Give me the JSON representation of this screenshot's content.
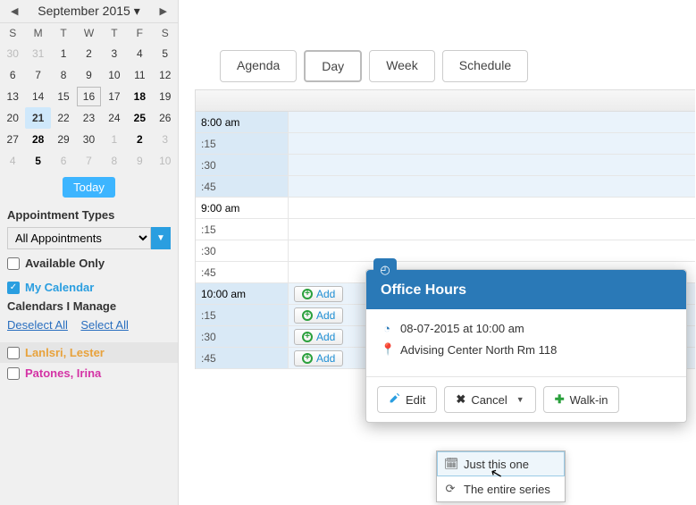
{
  "sidebar": {
    "month_title": "September 2015 ▾",
    "dow": [
      "S",
      "M",
      "T",
      "W",
      "T",
      "F",
      "S"
    ],
    "weeks": [
      [
        {
          "d": "30",
          "c": "other"
        },
        {
          "d": "31",
          "c": "other"
        },
        {
          "d": "1",
          "c": ""
        },
        {
          "d": "2",
          "c": ""
        },
        {
          "d": "3",
          "c": ""
        },
        {
          "d": "4",
          "c": ""
        },
        {
          "d": "5",
          "c": ""
        }
      ],
      [
        {
          "d": "6",
          "c": ""
        },
        {
          "d": "7",
          "c": ""
        },
        {
          "d": "8",
          "c": ""
        },
        {
          "d": "9",
          "c": ""
        },
        {
          "d": "10",
          "c": ""
        },
        {
          "d": "11",
          "c": ""
        },
        {
          "d": "12",
          "c": ""
        }
      ],
      [
        {
          "d": "13",
          "c": ""
        },
        {
          "d": "14",
          "c": ""
        },
        {
          "d": "15",
          "c": ""
        },
        {
          "d": "16",
          "c": "outlined"
        },
        {
          "d": "17",
          "c": ""
        },
        {
          "d": "18",
          "c": "bold"
        },
        {
          "d": "19",
          "c": ""
        }
      ],
      [
        {
          "d": "20",
          "c": ""
        },
        {
          "d": "21",
          "c": "today-blue"
        },
        {
          "d": "22",
          "c": ""
        },
        {
          "d": "23",
          "c": ""
        },
        {
          "d": "24",
          "c": ""
        },
        {
          "d": "25",
          "c": "bold"
        },
        {
          "d": "26",
          "c": ""
        }
      ],
      [
        {
          "d": "27",
          "c": ""
        },
        {
          "d": "28",
          "c": "bold"
        },
        {
          "d": "29",
          "c": ""
        },
        {
          "d": "30",
          "c": ""
        },
        {
          "d": "1",
          "c": "other"
        },
        {
          "d": "2",
          "c": "other bold"
        },
        {
          "d": "3",
          "c": "other"
        }
      ],
      [
        {
          "d": "4",
          "c": "other"
        },
        {
          "d": "5",
          "c": "other bold"
        },
        {
          "d": "6",
          "c": "other"
        },
        {
          "d": "7",
          "c": "other"
        },
        {
          "d": "8",
          "c": "other"
        },
        {
          "d": "9",
          "c": "other"
        },
        {
          "d": "10",
          "c": "other"
        }
      ]
    ],
    "today_label": "Today",
    "appt_types_heading": "Appointment Types",
    "appt_select_value": "All Appointments",
    "available_only": "Available Only",
    "my_calendar": "My Calendar",
    "manage_heading": "Calendars I Manage",
    "deselect_all": "Deselect All",
    "select_all": "Select All",
    "cal_a": "Lanlsri, Lester",
    "cal_b": "Patones, Irina"
  },
  "tabs": {
    "agenda": "Agenda",
    "day": "Day",
    "week": "Week",
    "schedule": "Schedule"
  },
  "grid": {
    "rows": [
      {
        "label": "8:00 am",
        "hour": true,
        "blue": true,
        "add": false
      },
      {
        "label": ":15",
        "hour": false,
        "blue": true,
        "add": false
      },
      {
        "label": ":30",
        "hour": false,
        "blue": true,
        "add": false
      },
      {
        "label": ":45",
        "hour": false,
        "blue": true,
        "add": false
      },
      {
        "label": "9:00 am",
        "hour": true,
        "blue": false,
        "add": false
      },
      {
        "label": ":15",
        "hour": false,
        "blue": false,
        "add": false
      },
      {
        "label": ":30",
        "hour": false,
        "blue": false,
        "add": false
      },
      {
        "label": ":45",
        "hour": false,
        "blue": false,
        "add": false
      },
      {
        "label": "10:00 am",
        "hour": true,
        "blue": true,
        "add": true
      },
      {
        "label": ":15",
        "hour": false,
        "blue": true,
        "add": true
      },
      {
        "label": ":30",
        "hour": false,
        "blue": true,
        "add": true
      },
      {
        "label": ":45",
        "hour": false,
        "blue": true,
        "add": true
      }
    ],
    "add_label": "Add"
  },
  "popup": {
    "title": "Office Hours",
    "datetime": "08-07-2015 at 10:00 am",
    "location": "Advising Center North Rm 118",
    "edit": "Edit",
    "cancel": "Cancel",
    "walkin": "Walk-in"
  },
  "dropdown": {
    "just_one": "Just this one",
    "entire": "The entire series"
  }
}
